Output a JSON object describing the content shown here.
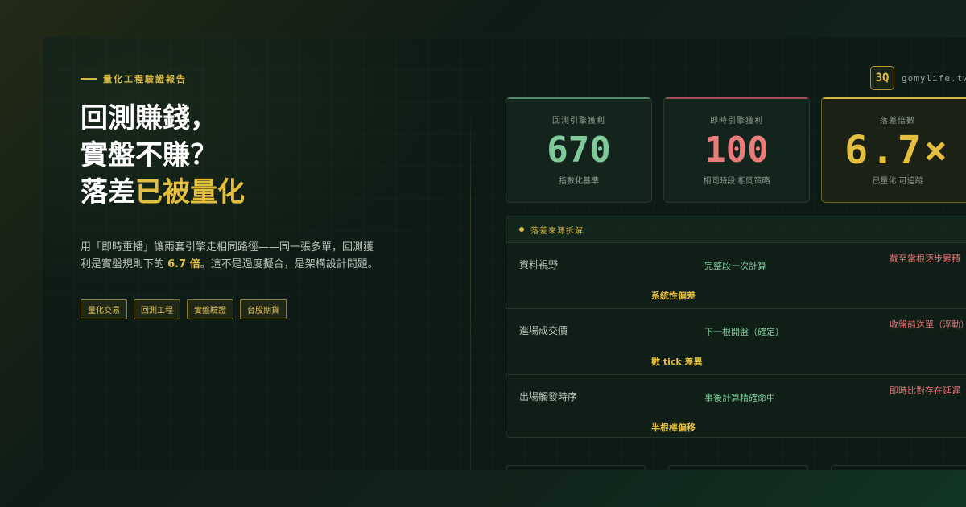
{
  "eyebrow": "量化工程驗證報告",
  "headline": {
    "line1": "回測賺錢，",
    "line2": "實盤不賺？",
    "line3_plain": "落差",
    "line3_accent": "已被量化"
  },
  "description": {
    "part1": "用「即時重播」讓兩套引擎走相同路徑——同一張多單，回測獲利是實盤規則下的 ",
    "highlight": "6.7 倍",
    "part2": "。這不是過度擬合，是架構設計問題。"
  },
  "tags": [
    "量化交易",
    "回測工程",
    "實盤驗證",
    "台股期貨"
  ],
  "logo": {
    "mark": "3Q",
    "site": "gomylife.tw"
  },
  "stats": [
    {
      "label": "回測引擎獲利",
      "value": "670",
      "sub": "指數化基準"
    },
    {
      "label": "即時引擎獲利",
      "value": "100",
      "sub": "相同時段 相同策略"
    },
    {
      "label": "落差倍數",
      "value": "6.7×",
      "sub": "已量化 可追蹤"
    }
  ],
  "breakdown": {
    "title": "落差來源拆解",
    "rows": [
      {
        "label": "資料視野",
        "backtest": "完整段一次計算",
        "live": "截至當根逐步累積",
        "diff": "系統性偏差"
      },
      {
        "label": "進場成交價",
        "backtest": "下一根開盤（確定）",
        "live": "收盤前送單（浮動）",
        "diff": "數 tick 差異"
      },
      {
        "label": "出場觸發時序",
        "backtest": "事後計算精確命中",
        "live": "即時比對存在延遲",
        "diff": "半根棒偏移"
      }
    ]
  },
  "colors": {
    "accent": "#e4bf3f",
    "green": "#7fc99b",
    "red": "#ec7b7b",
    "background": "#0d1a15"
  }
}
